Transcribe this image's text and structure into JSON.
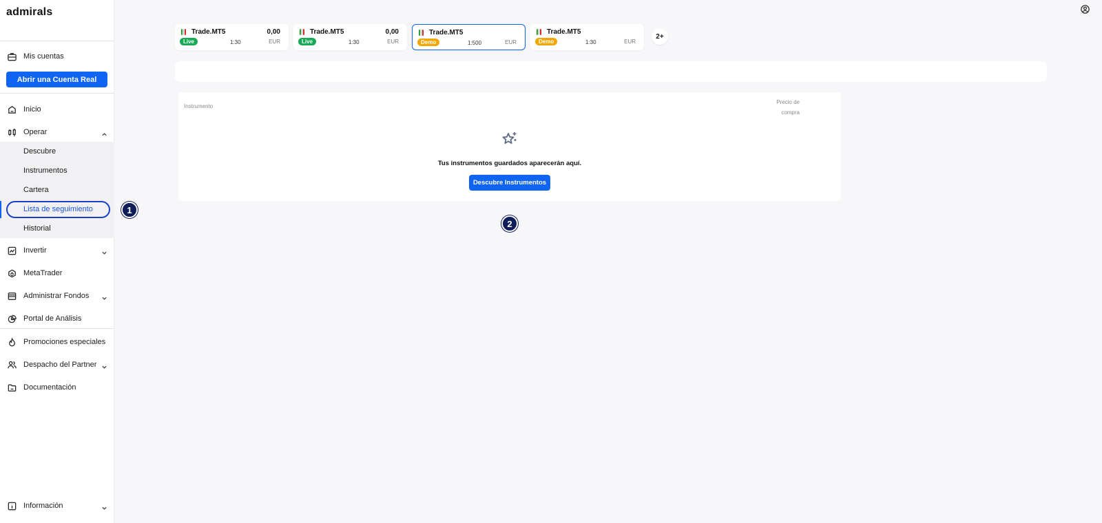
{
  "brand": {
    "logo_text": "admirals"
  },
  "sidebar": {
    "my_accounts": "Mis cuentas",
    "open_account_button": "Abrir una Cuenta Real",
    "inicio": "Inicio",
    "operar": "Operar",
    "operar_sub": [
      "Descubre",
      "Instrumentos",
      "Cartera",
      "Lista de seguimiento",
      "Historial"
    ],
    "invertir": "Invertir",
    "metatrader": "MetaTrader",
    "administrar_fondos": "Administrar Fondos",
    "portal_analisis": "Portal de Análisis",
    "promociones": "Promociones especiales",
    "despacho_partner": "Despacho del Partner",
    "documentacion": "Documentación",
    "informacion": "Información",
    "active_item": "Lista de seguimiento"
  },
  "annotations": {
    "marker1": "1",
    "marker2": "2"
  },
  "accounts": [
    {
      "name": "Trade.MT5",
      "balance": "0,00",
      "type": "Live",
      "leverage": "1:30",
      "currency": "EUR",
      "selected": false
    },
    {
      "name": "Trade.MT5",
      "balance": "0,00",
      "type": "Live",
      "leverage": "1:30",
      "currency": "EUR",
      "selected": false
    },
    {
      "name": "Trade.MT5",
      "balance": "",
      "type": "Demo",
      "leverage": "1:500",
      "currency": "EUR",
      "selected": true
    },
    {
      "name": "Trade.MT5",
      "balance": "",
      "type": "Demo",
      "leverage": "1:30",
      "currency": "EUR",
      "selected": false
    }
  ],
  "more_accounts": "2+",
  "watchlist": {
    "col_instrument": "Instrumento",
    "col_price_line1": "Precio de",
    "col_price_line2": "compra",
    "empty_message": "Tus instrumentos guardados aparecerán aquí.",
    "discover_button": "Descubre Instrumentos"
  },
  "colors": {
    "primary": "#1064f2",
    "live": "#18a957",
    "demo": "#f0a800",
    "marker": "#0f1c5a"
  },
  "icons": {
    "user": "user-circle-icon",
    "empty_state": "star-sparkle-icon"
  }
}
